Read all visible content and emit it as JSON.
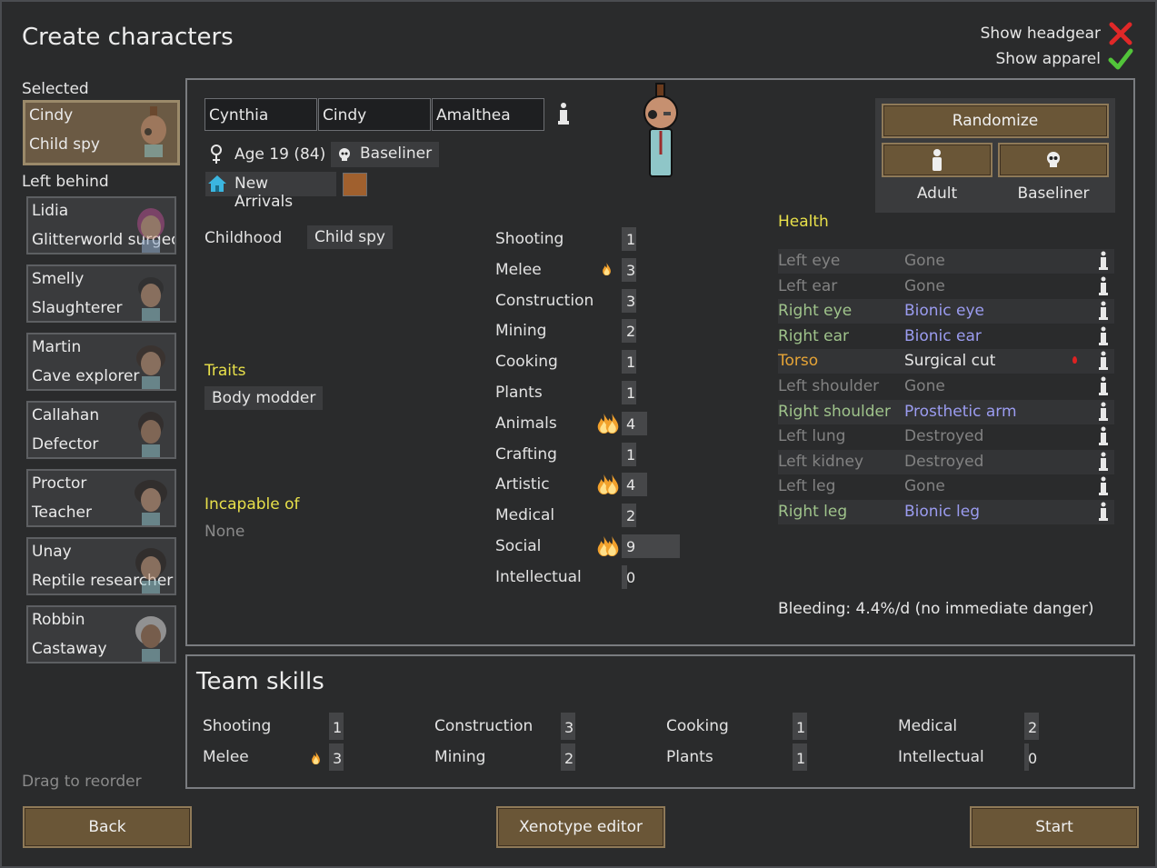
{
  "title": "Create characters",
  "toggles": {
    "headgear_label": "Show headgear",
    "apparel_label": "Show apparel",
    "headgear_on": false,
    "apparel_on": true
  },
  "sidebar": {
    "selected_label": "Selected",
    "left_behind_label": "Left behind",
    "drag_hint": "Drag to reorder",
    "selected": {
      "name": "Cindy",
      "role": "Child spy"
    },
    "left_behind": [
      {
        "name": "Lidia",
        "role": "Glitterworld surgeon"
      },
      {
        "name": "Smelly",
        "role": "Slaughterer"
      },
      {
        "name": "Martin",
        "role": "Cave explorer"
      },
      {
        "name": "Callahan",
        "role": "Defector"
      },
      {
        "name": "Proctor",
        "role": "Teacher"
      },
      {
        "name": "Unay",
        "role": "Reptile researcher"
      },
      {
        "name": "Robbin",
        "role": "Castaway"
      }
    ]
  },
  "pawn": {
    "first_name": "Cynthia",
    "nick_name": "Cindy",
    "last_name": "Amalthea",
    "age": "Age 19 (84)",
    "xenotype": "Baseliner",
    "faction": "New Arrivals",
    "faction_color": "#a0602e",
    "childhood_label": "Childhood",
    "childhood": "Child spy",
    "traits_label": "Traits",
    "traits": [
      "Body modder"
    ],
    "incapable_label": "Incapable of",
    "incapable": "None"
  },
  "randomize": {
    "randomize_label": "Randomize",
    "dev_stage_label": "Adult",
    "xenotype_label": "Baseliner"
  },
  "skills": [
    {
      "name": "Shooting",
      "level": 1,
      "passion": 0
    },
    {
      "name": "Melee",
      "level": 3,
      "passion": 1
    },
    {
      "name": "Construction",
      "level": 3,
      "passion": 0
    },
    {
      "name": "Mining",
      "level": 2,
      "passion": 0
    },
    {
      "name": "Cooking",
      "level": 1,
      "passion": 0
    },
    {
      "name": "Plants",
      "level": 1,
      "passion": 0
    },
    {
      "name": "Animals",
      "level": 4,
      "passion": 2
    },
    {
      "name": "Crafting",
      "level": 1,
      "passion": 0
    },
    {
      "name": "Artistic",
      "level": 4,
      "passion": 2
    },
    {
      "name": "Medical",
      "level": 2,
      "passion": 0
    },
    {
      "name": "Social",
      "level": 9,
      "passion": 2
    },
    {
      "name": "Intellectual",
      "level": 0,
      "passion": 0
    }
  ],
  "health": {
    "label": "Health",
    "rows": [
      {
        "part": "Left eye",
        "condition": "Gone",
        "tone": "grey"
      },
      {
        "part": "Left ear",
        "condition": "Gone",
        "tone": "grey"
      },
      {
        "part": "Right eye",
        "condition": "Bionic eye",
        "tone": "bionic"
      },
      {
        "part": "Right ear",
        "condition": "Bionic ear",
        "tone": "bionic"
      },
      {
        "part": "Torso",
        "condition": "Surgical cut",
        "tone": "injury",
        "bleeding": true
      },
      {
        "part": "Left shoulder",
        "condition": "Gone",
        "tone": "grey"
      },
      {
        "part": "Right shoulder",
        "condition": "Prosthetic arm",
        "tone": "bionic"
      },
      {
        "part": "Left lung",
        "condition": "Destroyed",
        "tone": "grey"
      },
      {
        "part": "Left kidney",
        "condition": "Destroyed",
        "tone": "grey"
      },
      {
        "part": "Left leg",
        "condition": "Gone",
        "tone": "grey"
      },
      {
        "part": "Right leg",
        "condition": "Bionic leg",
        "tone": "bionic"
      }
    ],
    "bleeding": "Bleeding: 4.4%/d (no immediate danger)"
  },
  "team": {
    "title": "Team skills",
    "skills": [
      {
        "name": "Shooting",
        "level": 1,
        "passion": 0
      },
      {
        "name": "Melee",
        "level": 3,
        "passion": 1
      },
      {
        "name": "Construction",
        "level": 3,
        "passion": 0
      },
      {
        "name": "Mining",
        "level": 2,
        "passion": 0
      },
      {
        "name": "Cooking",
        "level": 1,
        "passion": 0
      },
      {
        "name": "Plants",
        "level": 1,
        "passion": 0
      },
      {
        "name": "Medical",
        "level": 2,
        "passion": 0
      },
      {
        "name": "Intellectual",
        "level": 0,
        "passion": 0
      }
    ]
  },
  "footer": {
    "back": "Back",
    "xenotype_editor": "Xenotype editor",
    "start": "Start"
  }
}
